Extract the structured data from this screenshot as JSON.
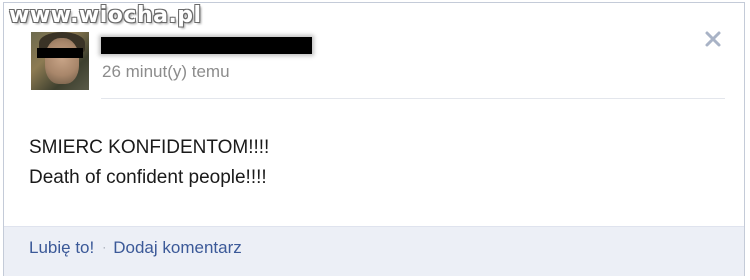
{
  "watermark": "www.wiocha.pl",
  "post": {
    "timestamp": "26 minut(y) temu",
    "lines": [
      "SMIERC KONFIDENTOM!!!!",
      "Death of confident people!!!!"
    ]
  },
  "actions": {
    "like_label": "Lubię to!",
    "separator": "·",
    "comment_label": "Dodaj komentarz"
  },
  "colors": {
    "link": "#3b5998",
    "footer_bg": "#eceff6",
    "timestamp": "#8c8c8c"
  },
  "icons": {
    "close": "close-icon"
  }
}
